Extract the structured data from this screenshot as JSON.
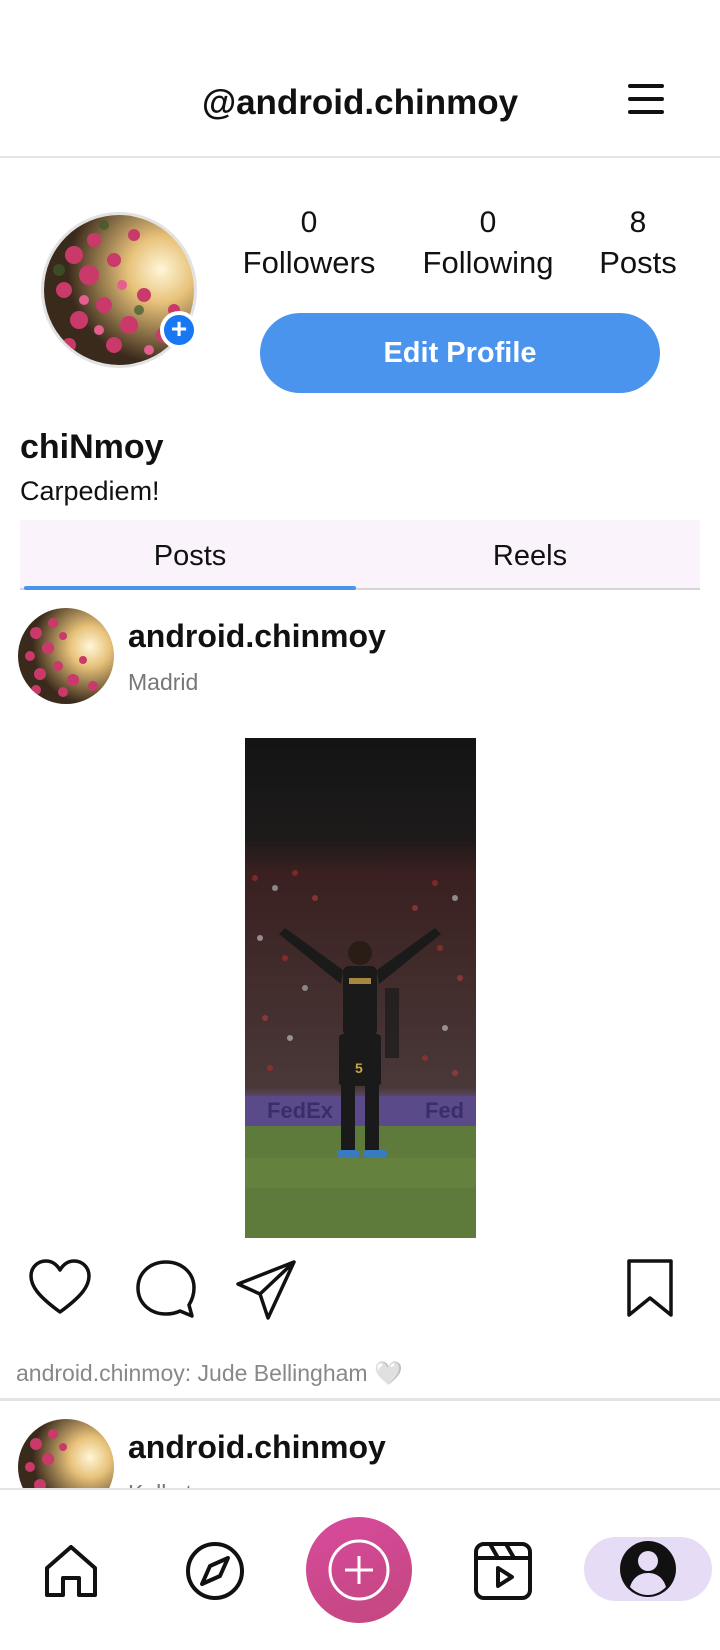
{
  "header": {
    "handle": "@android.chinmoy"
  },
  "profile": {
    "stats": [
      {
        "value": "0",
        "label": "Followers"
      },
      {
        "value": "0",
        "label": "Following"
      },
      {
        "value": "8",
        "label": "Posts"
      }
    ],
    "edit_button": "Edit Profile",
    "display_name": "chiNmoy",
    "bio": "Carpediem!"
  },
  "tabs": [
    {
      "label": "Posts",
      "active": true
    },
    {
      "label": "Reels",
      "active": false
    }
  ],
  "posts": [
    {
      "username": "android.chinmoy",
      "location": "Madrid",
      "caption": "android.chinmoy: Jude Bellingham 🤍"
    },
    {
      "username": "android.chinmoy",
      "location": "Kolkata"
    }
  ],
  "bottom_nav": {
    "items": [
      "home-icon",
      "explore-icon",
      "add-post-icon",
      "reels-icon",
      "profile-icon"
    ],
    "active": "profile-icon"
  },
  "colors": {
    "accent": "#4a94ee",
    "fab": "#d0468e",
    "active_pill": "#e6dcf6",
    "tab_bg": "#fbf3fb"
  }
}
